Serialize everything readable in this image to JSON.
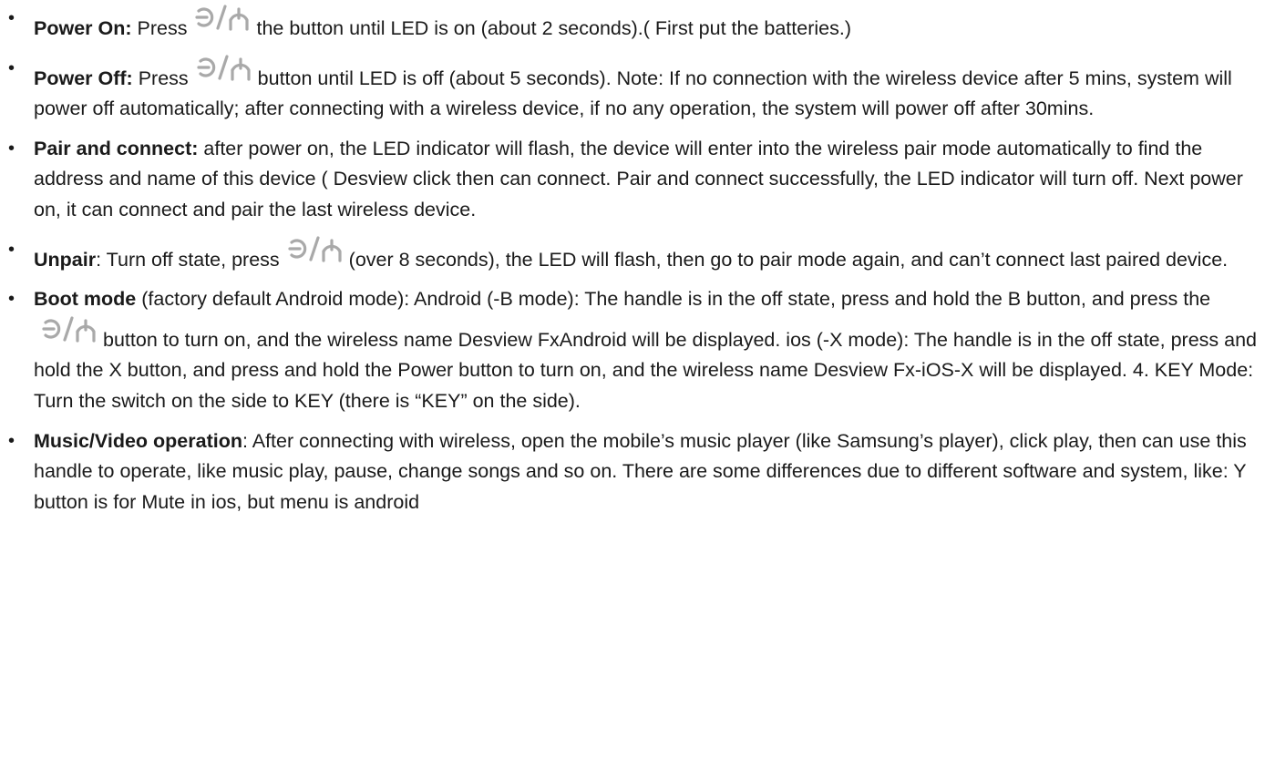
{
  "items": [
    {
      "term": "Power On:",
      "text_before_icon": "Press",
      "text_after_icon": "the button until LED is on (about 2 seconds).( First put the batteries.)"
    },
    {
      "term": "Power Off:",
      "text_before_icon": "Press",
      "text_after_icon": "button until LED is off (about 5 seconds). Note: If no connection with the wireless device after  5 mins, system will power off automatically; after connecting with a wireless device, if no any operation, the system will power off after 30mins."
    },
    {
      "term": "Pair and connect:",
      "text": "after power on, the LED indicator will flash, the device will enter into the wireless pair mode automatically to find the address and name of this device ( Desview click then can connect. Pair and connect successfully, the LED indicator will turn off. Next power on, it can connect and pair the last wireless device."
    },
    {
      "term": "Unpair",
      "text_before_icon": ":  Turn off state, press",
      "text_after_icon": "(over 8 seconds), the LED will flash, then go to pair mode again, and can’t connect last paired device."
    },
    {
      "term": "Boot mode",
      "text_before_icon": "(factory default Android mode): Android (-B mode): The handle is in the off state, press and hold the B button, and press the",
      "text_after_icon": "button to turn on, and the wireless name Desview FxAndroid will be displayed. ios (-X mode): The handle is in the off state, press and hold the X button, and press and hold the Power button to turn on, and the wireless name Desview Fx-iOS-X will be displayed. 4. KEY Mode: Turn the switch on the side to KEY (there is “KEY” on the side)."
    },
    {
      "term": "Music/Video operation",
      "text": ": After connecting with wireless, open the mobile’s music player (like Samsung’s player), click play, then can use this handle to operate, like music play, pause, change songs and so on. There are some differences due to different software and system, like: Y button is for Mute in ios, but menu is android"
    }
  ],
  "bullet_glyph": "•",
  "icon_name": "power-toggle-icon",
  "icon_color": "#a9a9a9"
}
